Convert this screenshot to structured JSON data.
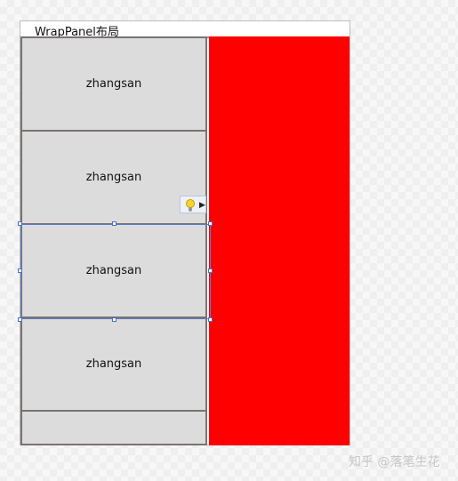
{
  "window": {
    "title": "WrapPanel布局"
  },
  "wrap_panel": {
    "items": [
      {
        "label": "zhangsan"
      },
      {
        "label": "zhangsan"
      },
      {
        "label": "zhangsan"
      },
      {
        "label": "zhangsan"
      },
      {
        "label": ""
      }
    ],
    "right_panel_color": "#ff0000"
  },
  "smart_tag": {
    "icon": "lightbulb-icon",
    "arrow_icon": "triangle-right-icon"
  },
  "watermark": "知乎 @落笔生花"
}
